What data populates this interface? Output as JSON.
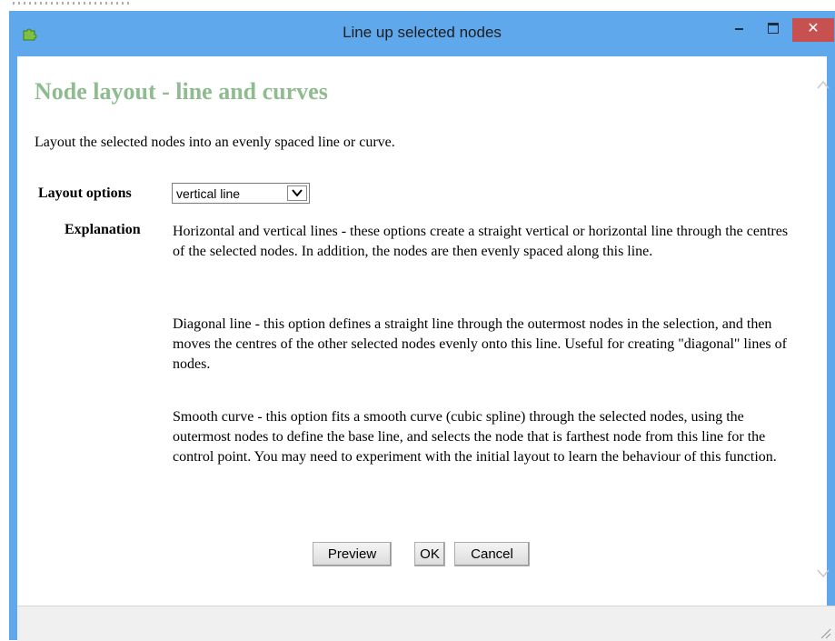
{
  "window": {
    "title": "Line up selected nodes",
    "close_glyph": "✕"
  },
  "page": {
    "heading": "Node layout - line and curves",
    "intro": "Layout the selected nodes into an evenly spaced line or curve."
  },
  "form": {
    "layout_options_label": "Layout options",
    "layout_options_value": "vertical line",
    "explanation_label": "Explanation",
    "explanation_paragraphs": [
      "Horizontal and vertical lines - these options create a straight vertical or horizontal line through the centres of the selected nodes. In addition, the nodes are then evenly spaced along this line.",
      "Diagonal line - this option defines a straight line through the outermost nodes in the selection, and then moves the centres of the other selected nodes evenly onto this line. Useful for creating \"diagonal\" lines of nodes.",
      "Smooth curve - this option fits a smooth curve (cubic spline) through the selected nodes, using the outermost nodes to define the base line, and selects the node that is farthest node from this line for the control point. You may need to experiment with the initial layout to learn the behaviour of this function."
    ]
  },
  "buttons": {
    "preview": "Preview",
    "ok": "OK",
    "cancel": "Cancel"
  },
  "icons": {
    "app": "puzzle-piece-icon",
    "minimize": "minimize-icon",
    "maximize": "maximize-icon",
    "close": "close-icon",
    "dropdown": "chevron-down-icon",
    "scroll_up": "chevron-up-icon",
    "scroll_down": "chevron-down-icon",
    "resize": "resize-grip-icon"
  },
  "colors": {
    "title_bar": "#5fa8ec",
    "close_button": "#c75050",
    "heading": "#8fbc8f",
    "status_bar": "#f0f0f0"
  }
}
